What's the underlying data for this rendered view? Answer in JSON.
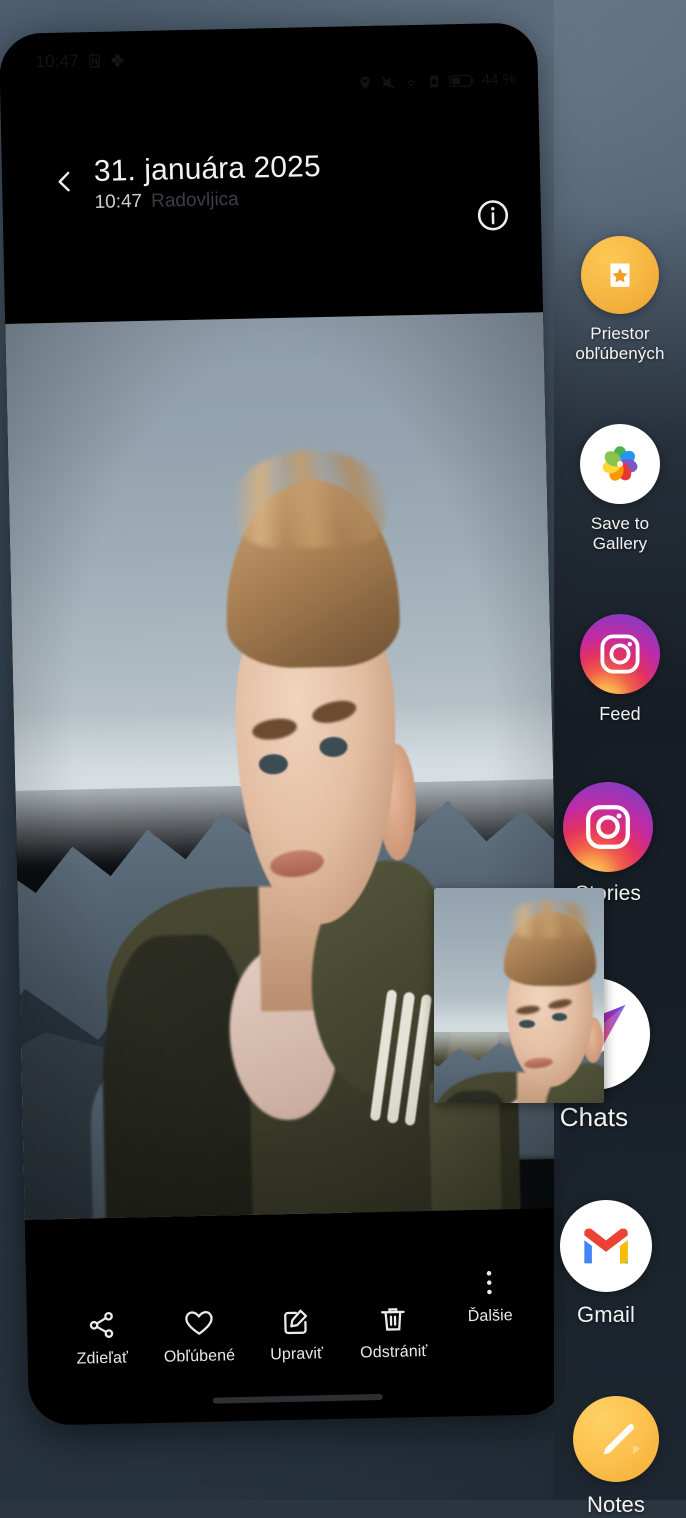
{
  "status_bar": {
    "clock": "10:47",
    "battery_percent": "44 %",
    "left_icons": [
      "nfc-icon",
      "pinwheel-icon"
    ],
    "right_icons": [
      "location-icon",
      "mute-icon",
      "wifi-icon",
      "sim-card-icon",
      "battery-icon"
    ]
  },
  "app_header": {
    "back_icon": "chevron-left-icon",
    "title": "31. januára 2025",
    "time": "10:47",
    "location": "Radovljica",
    "info_icon": "info-circle-icon"
  },
  "photo": {
    "alt": "Man in olive green jacket on a snowy mountain ridge at sunrise"
  },
  "toolbar": {
    "items": [
      {
        "label": "Zdieľať",
        "icon": "share-nodes-icon"
      },
      {
        "label": "Obľúbené",
        "icon": "heart-icon"
      },
      {
        "label": "Upraviť",
        "icon": "pencil-square-icon"
      },
      {
        "label": "Odstrániť",
        "icon": "trash-icon"
      },
      {
        "label": "Ďalšie",
        "icon": "more-vertical-icon"
      }
    ]
  },
  "share_sidebar": {
    "apps": [
      {
        "label": "Priestor obľúbených",
        "icon": "favorites-space-icon",
        "label_line1": "Priestor",
        "label_line2": "obľúbených"
      },
      {
        "label": "Save to Gallery",
        "icon": "gallery-pinwheel-icon",
        "label_line1": "Save to",
        "label_line2": "Gallery"
      },
      {
        "label": "Feed",
        "icon": "instagram-icon"
      },
      {
        "label": "Stories",
        "icon": "instagram-icon"
      },
      {
        "label": "Chats",
        "icon": "instagram-direct-icon"
      },
      {
        "label": "Gmail",
        "icon": "gmail-icon"
      },
      {
        "label": "Notes",
        "icon": "notes-pencil-icon"
      }
    ]
  },
  "colors": {
    "accent_orange": "#f7b844",
    "instagram_magenta": "#c32aa3",
    "gmail_red": "#ea4335",
    "sidebar_dark": "#161d25",
    "screen_black": "#000000"
  }
}
